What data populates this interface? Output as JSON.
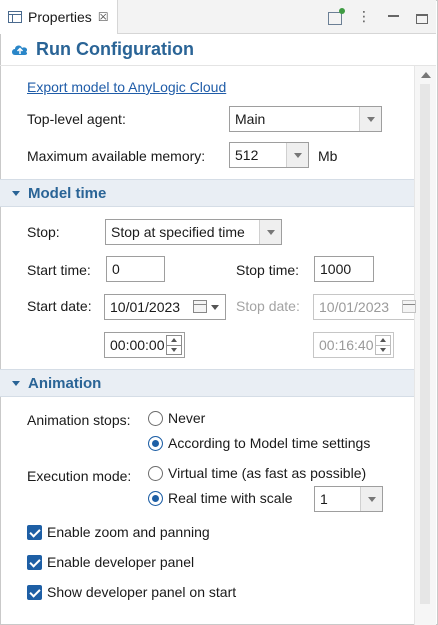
{
  "tab": {
    "title": "Properties",
    "close_glyph": "☒"
  },
  "toolbar": {
    "icons": [
      "new-properties-icon",
      "view-menu-icon",
      "minimize-icon",
      "maximize-icon"
    ]
  },
  "header": {
    "title": "Run Configuration",
    "icon": "cloud-upload-icon"
  },
  "main": {
    "export_link": "Export model to AnyLogic Cloud",
    "top_level_agent_label": "Top-level agent:",
    "top_level_agent_value": "Main",
    "max_memory_label": "Maximum available memory:",
    "max_memory_value": "512",
    "max_memory_unit": "Mb"
  },
  "model_time": {
    "title": "Model time",
    "stop_label": "Stop:",
    "stop_value": "Stop at specified time",
    "start_time_label": "Start time:",
    "start_time_value": "0",
    "stop_time_label": "Stop time:",
    "stop_time_value": "1000",
    "start_date_label": "Start date:",
    "start_date_value": "10/01/2023",
    "start_clock_value": "00:00:00",
    "stop_date_label": "Stop date:",
    "stop_date_value": "10/01/2023",
    "stop_clock_value": "00:16:40"
  },
  "animation": {
    "title": "Animation",
    "animation_stops_label": "Animation stops:",
    "option_never": "Never",
    "option_model_time": "According to Model time settings",
    "execution_mode_label": "Execution mode:",
    "option_virtual": "Virtual time (as fast as possible)",
    "option_real": "Real time with scale",
    "real_time_scale": "1",
    "check_zoom": "Enable zoom and panning",
    "check_dev_panel": "Enable developer panel",
    "check_show_dev_panel": "Show developer panel on start"
  },
  "colors": {
    "accent": "#2a6496",
    "link": "#1f5ca8",
    "control": "#1e5fa5"
  }
}
